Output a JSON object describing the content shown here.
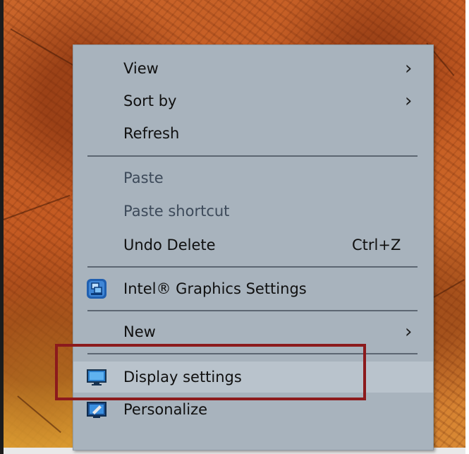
{
  "menu": {
    "items": [
      {
        "label": "View",
        "submenu": true
      },
      {
        "label": "Sort by",
        "submenu": true
      },
      {
        "label": "Refresh"
      },
      {
        "label": "Paste",
        "disabled": true
      },
      {
        "label": "Paste shortcut",
        "disabled": true
      },
      {
        "label": "Undo Delete",
        "shortcut": "Ctrl+Z"
      },
      {
        "label": "Intel® Graphics Settings",
        "icon": "intel-graphics-icon"
      },
      {
        "label": "New",
        "submenu": true
      },
      {
        "label": "Display settings",
        "icon": "monitor-icon",
        "highlighted": true
      },
      {
        "label": "Personalize",
        "icon": "personalize-icon"
      }
    ],
    "submenu_arrow": "›"
  },
  "colors": {
    "menu_background": "#a8b3bd",
    "highlight_background": "#b9c3cc",
    "callout_border": "#8c1a1c",
    "disabled_text": "#3d4a5a"
  }
}
